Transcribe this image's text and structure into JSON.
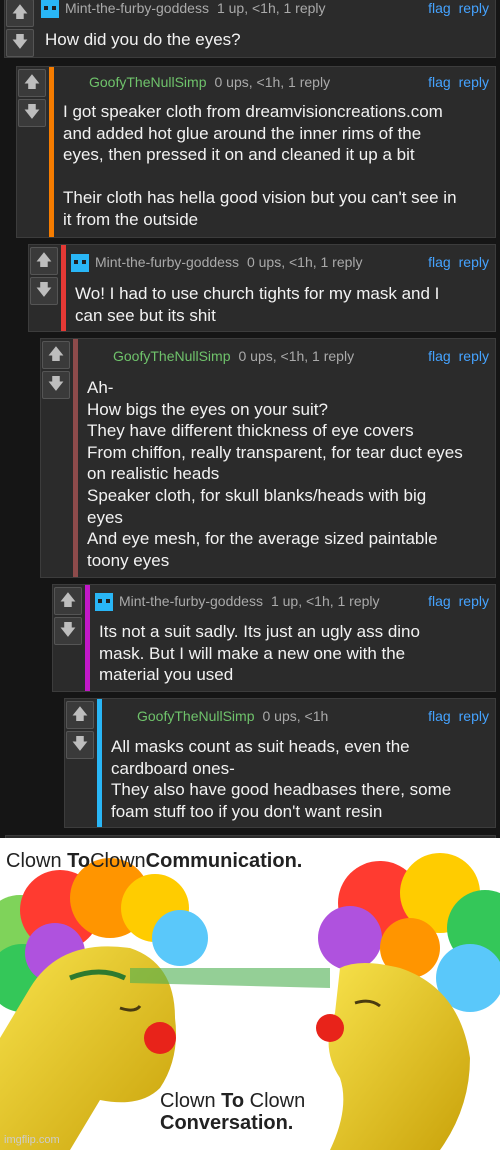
{
  "comments": [
    {
      "username": "Mint-the-furby-goddess",
      "meta": "1 up, <1h, 1 reply",
      "flag": "flag",
      "reply": "reply",
      "lines": [
        "How did you do the eyes?"
      ],
      "bar_color": "#2b2b2b"
    },
    {
      "username": "GoofyTheNullSimp",
      "meta": "0 ups, <1h, 1 reply",
      "flag": "flag",
      "reply": "reply",
      "lines": [
        "I got speaker cloth from dreamvisioncreations.com",
        "and added hot glue around the inner rims of the",
        "eyes, then pressed it on and cleaned it up a bit",
        "",
        "Their cloth has hella good vision but you can't see in",
        "it from the outside"
      ],
      "bar_color": "#f57c00"
    },
    {
      "username": "Mint-the-furby-goddess",
      "meta": "0 ups, <1h, 1 reply",
      "flag": "flag",
      "reply": "reply",
      "lines": [
        "Wo! I had to use church tights for my mask and I",
        "can see but its shit"
      ],
      "bar_color": "#e53935"
    },
    {
      "username": "GoofyTheNullSimp",
      "meta": "0 ups, <1h, 1 reply",
      "flag": "flag",
      "reply": "reply",
      "lines": [
        "Ah-",
        "How bigs the eyes on your suit?",
        "They have different thickness of eye covers",
        "From chiffon, really transparent, for tear duct eyes",
        "on realistic heads",
        "Speaker cloth, for skull blanks/heads with big",
        "eyes",
        "And eye mesh, for the average sized paintable",
        "toony eyes"
      ],
      "bar_color": "#8d4b4b"
    },
    {
      "username": "Mint-the-furby-goddess",
      "meta": "1 up, <1h, 1 reply",
      "flag": "flag",
      "reply": "reply",
      "lines": [
        "Its not a suit sadly. Its just an ugly ass dino",
        "mask. But I will make a new one with the",
        "material you used"
      ],
      "bar_color": "#c218c8"
    },
    {
      "username": "GoofyTheNullSimp",
      "meta": "0 ups, <1h",
      "flag": "flag",
      "reply": "reply",
      "lines": [
        "All masks count as suit heads, even the",
        "cardboard ones-",
        "They also have good headbases there, some",
        "foam stuff too if you don't want resin"
      ],
      "bar_color": "#29b6f6"
    }
  ],
  "vote": {
    "up": "🡅",
    "down": "🡇"
  },
  "meme": {
    "title_a": "Clown ",
    "title_b": "To",
    "title_c": "Clown",
    "title_d": "Communication.",
    "cap1_a": "Clown ",
    "cap1_b": "To",
    "cap1_c": " Clown",
    "cap2": "Conversation.",
    "watermark": "imgflip.com"
  }
}
